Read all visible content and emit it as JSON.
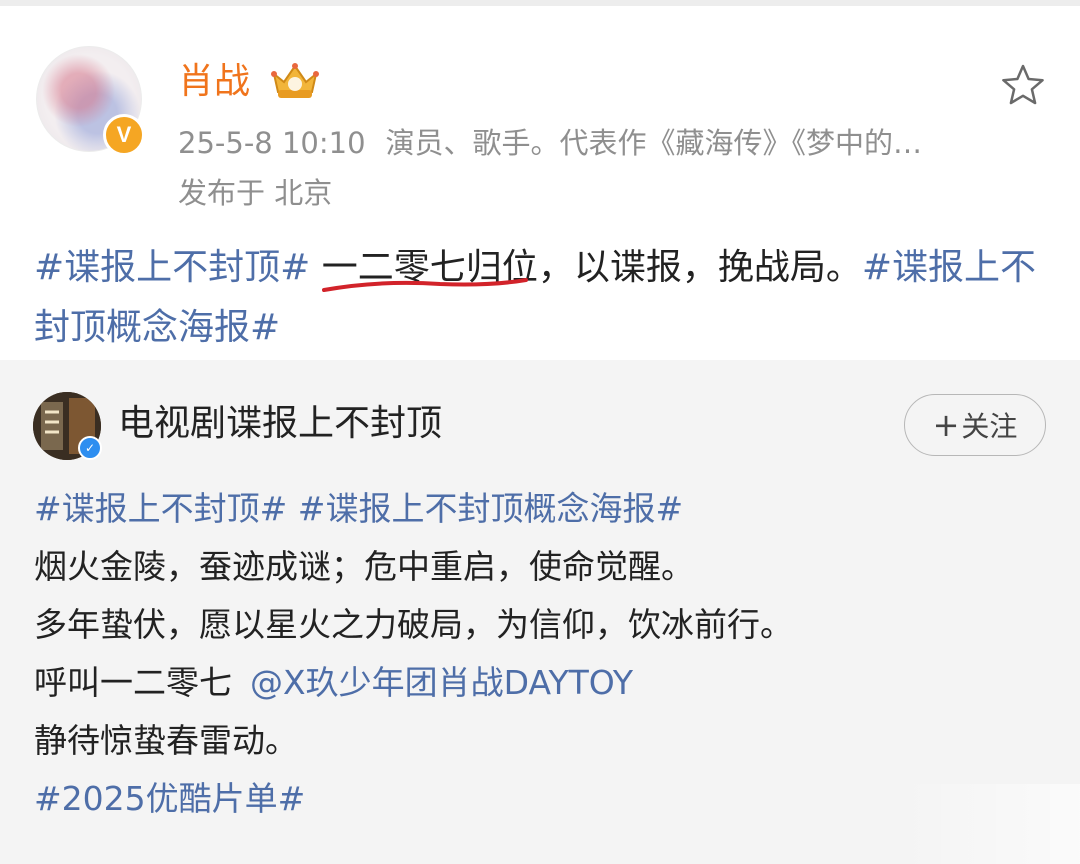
{
  "post": {
    "username": "肖战",
    "time": "25-5-8 10:10",
    "bio": "演员、歌手。代表作《藏海传》《梦中的…",
    "location": "发布于 北京",
    "text": {
      "tag1": "#谍报上不封顶#",
      "highlight": "一二零七",
      "rest": "归位，以谍报，挽战局。",
      "tag2": "#谍报上不封顶概念海报#"
    }
  },
  "quote": {
    "username": "电视剧谍报上不封顶",
    "follow_label": "关注",
    "tags_line": "#谍报上不封顶# #谍报上不封顶概念海报#",
    "line1": "烟火金陵，蚕迹成谜；危中重启，使命觉醒。",
    "line2": "多年蛰伏，愿以星火之力破局，为信仰，饮冰前行。",
    "line3_text": "呼叫一二零七",
    "line3_mention": "@X玖少年团肖战DAYTOY",
    "line4": "静待惊蛰春雷动。",
    "line5_tag": "#2025优酷片单#"
  },
  "colors": {
    "username_orange": "#f0741c",
    "link_blue": "#4e6ea8",
    "meta_gray": "#8f8f8f",
    "quote_bg": "#f4f4f4",
    "underline_red": "#d2232a",
    "verified_gold": "#f5a623",
    "verified_blue": "#2d8ef0"
  },
  "icons": [
    "verified-gold-icon",
    "crown-level-icon",
    "star-favorite-icon",
    "verified-blue-icon",
    "plus-icon"
  ]
}
